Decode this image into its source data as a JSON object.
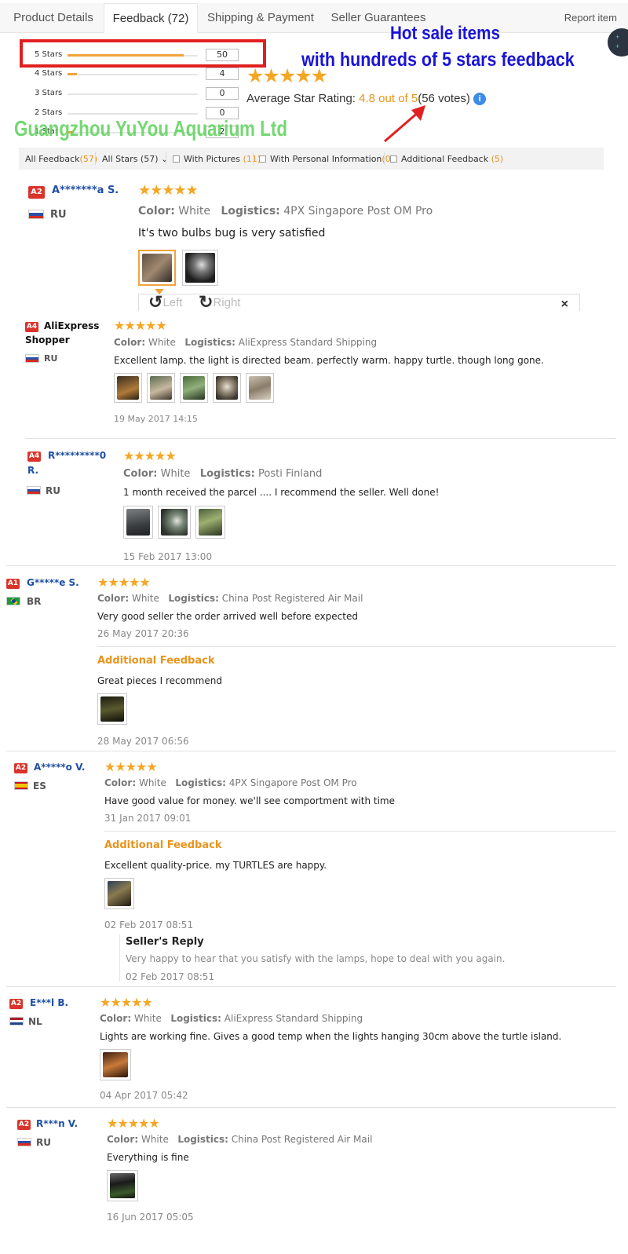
{
  "tabs": [
    {
      "label": "Product Details"
    },
    {
      "label": "Feedback (72)"
    },
    {
      "label": "Shipping & Payment"
    },
    {
      "label": "Seller Guarantees"
    }
  ],
  "report_label": "Report item",
  "rating_rows": [
    {
      "label": "5 Stars",
      "count": "50",
      "fraction": 0.893
    },
    {
      "label": "4 Stars",
      "count": "4",
      "fraction": 0.071
    },
    {
      "label": "3 Stars",
      "count": "0",
      "fraction": 0
    },
    {
      "label": "2 Stars",
      "count": "0",
      "fraction": 0
    },
    {
      "label": "1 Star",
      "count": "2",
      "fraction": 0.036
    }
  ],
  "summary": {
    "stars": "★★★★★",
    "avg_label": "Average Star Rating:",
    "avg_value": "4.8 out of 5",
    "votes": "(56 votes)",
    "info_glyph": "i"
  },
  "promo": {
    "line1": "Hot sale items",
    "line2": "with hundreds of 5 stars feedback",
    "color": "#1a14d8"
  },
  "watermark": "Guangzhou YuYou Aquarium Ltd",
  "filters": {
    "all_feedback_label": "All Feedback",
    "all_feedback_count": "(57)",
    "all_stars": "All Stars (57)",
    "with_pictures_label": "With Pictures",
    "with_pictures_count": "(11)",
    "personal_info_label": "With Personal Information",
    "personal_info_count": "(0)",
    "additional_label": "Additional Feedback",
    "additional_count": "(5)"
  },
  "viewer": {
    "left": "Left",
    "right": "Right",
    "close": "×"
  },
  "reviews": [
    {
      "level": "A2",
      "name": "A*******a S.",
      "country": "RU",
      "stars": "★★★★★",
      "color_label": "Color:",
      "color": "White",
      "logistics_label": "Logistics:",
      "logistics": "4PX Singapore Post OM Pro",
      "text": "It's two bulbs bug is very satisfied"
    },
    {
      "level": "A4",
      "name_line1": "AliExpress",
      "name_line2": "Shopper",
      "country": "RU",
      "stars": "★★★★★",
      "color_label": "Color:",
      "color": "White",
      "logistics_label": "Logistics:",
      "logistics": "AliExpress Standard Shipping",
      "text": "Excellent lamp. the light is directed beam. perfectly warm. happy turtle. though long gone.",
      "date": "19 May 2017 14:15"
    },
    {
      "level": "A4",
      "name_line1": "R*********0",
      "name_line2": "R.",
      "country": "RU",
      "stars": "★★★★★",
      "color_label": "Color:",
      "color": "White",
      "logistics_label": "Logistics:",
      "logistics": "Posti Finland",
      "text": "1 month received the parcel .... I recommend the seller. Well done!",
      "date": "15 Feb 2017 13:00"
    },
    {
      "level": "A1",
      "name": "G*****e S.",
      "country": "BR",
      "stars": "★★★★★",
      "color_label": "Color:",
      "color": "White",
      "logistics_label": "Logistics:",
      "logistics": "China Post Registered Air Mail",
      "text": "Very good seller the order arrived well before expected",
      "date": "26 May 2017 20:36",
      "additional_title": "Additional Feedback",
      "additional_text": "Great pieces I recommend",
      "additional_date": "28 May 2017 06:56"
    },
    {
      "level": "A2",
      "name": "A*****o V.",
      "country": "ES",
      "stars": "★★★★★",
      "color_label": "Color:",
      "color": "White",
      "logistics_label": "Logistics:",
      "logistics": "4PX Singapore Post OM Pro",
      "text": "Have good value for money. we'll see comportment with time",
      "date": "31 Jan 2017 09:01",
      "additional_title": "Additional Feedback",
      "additional_text": "Excellent quality-price. my TURTLES are happy.",
      "additional_date": "02 Feb 2017 08:51",
      "reply_title": "Seller's Reply",
      "reply_text": "Very happy to hear that you satisfy with the lamps, hope to deal with you again.",
      "reply_date": "02 Feb 2017 08:51"
    },
    {
      "level": "A2",
      "name": "E***l B.",
      "country": "NL",
      "stars": "★★★★★",
      "color_label": "Color:",
      "color": "White",
      "logistics_label": "Logistics:",
      "logistics": "AliExpress Standard Shipping",
      "text": "Lights are working fine. Gives a good temp when the lights hanging 30cm above the turtle island.",
      "date": "04 Apr 2017 05:42"
    },
    {
      "level": "A2",
      "name": "R***n V.",
      "country": "RU",
      "stars": "★★★★★",
      "color_label": "Color:",
      "color": "White",
      "logistics_label": "Logistics:",
      "logistics": "China Post Registered Air Mail",
      "text": "Everything is fine",
      "date": "16 Jun 2017 05:05"
    }
  ]
}
